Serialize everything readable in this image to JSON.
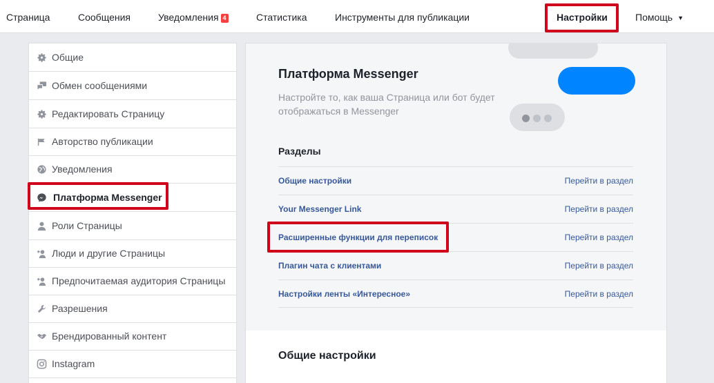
{
  "topnav": {
    "page": "Страница",
    "messages": "Сообщения",
    "notifications": "Уведомления",
    "notifications_badge": "4",
    "insights": "Статистика",
    "publishing_tools": "Инструменты для публикации",
    "settings": "Настройки",
    "help": "Помощь",
    "help_caret": "▼"
  },
  "sidebar": {
    "items": [
      {
        "label": "Общие",
        "icon": "gear-icon"
      },
      {
        "label": "Обмен сообщениями",
        "icon": "chat-icon"
      },
      {
        "label": "Редактировать Страницу",
        "icon": "gear-icon"
      },
      {
        "label": "Авторство публикации",
        "icon": "flag-icon"
      },
      {
        "label": "Уведомления",
        "icon": "globe-icon"
      },
      {
        "label": "Платформа Messenger",
        "icon": "messenger-icon",
        "active": true
      },
      {
        "label": "Роли Страницы",
        "icon": "person-icon"
      },
      {
        "label": "Люди и другие Страницы",
        "icon": "person-add-icon"
      },
      {
        "label": "Предпочитаемая аудитория Страницы",
        "icon": "person-add-icon"
      },
      {
        "label": "Разрешения",
        "icon": "wrench-icon"
      },
      {
        "label": "Брендированный контент",
        "icon": "handshake-icon"
      },
      {
        "label": "Instagram",
        "icon": "instagram-icon"
      }
    ]
  },
  "main": {
    "title": "Платформа Messenger",
    "description": "Настройте то, как ваша Страница или бот будет отображаться в Messenger",
    "sections_title": "Разделы",
    "sections": [
      {
        "name": "Общие настройки",
        "link": "Перейти в раздел"
      },
      {
        "name": "Your Messenger Link",
        "link": "Перейти в раздел"
      },
      {
        "name": "Расширенные функции для переписок",
        "link": "Перейти в раздел"
      },
      {
        "name": "Плагин чата с клиентами",
        "link": "Перейти в раздел"
      },
      {
        "name": "Настройки ленты «Интересное»",
        "link": "Перейти в раздел"
      }
    ],
    "general_title": "Общие настройки"
  },
  "colors": {
    "highlight": "#d0021b",
    "link": "#365899",
    "messenger_blue": "#0084ff",
    "badge": "#fa3e3e"
  }
}
